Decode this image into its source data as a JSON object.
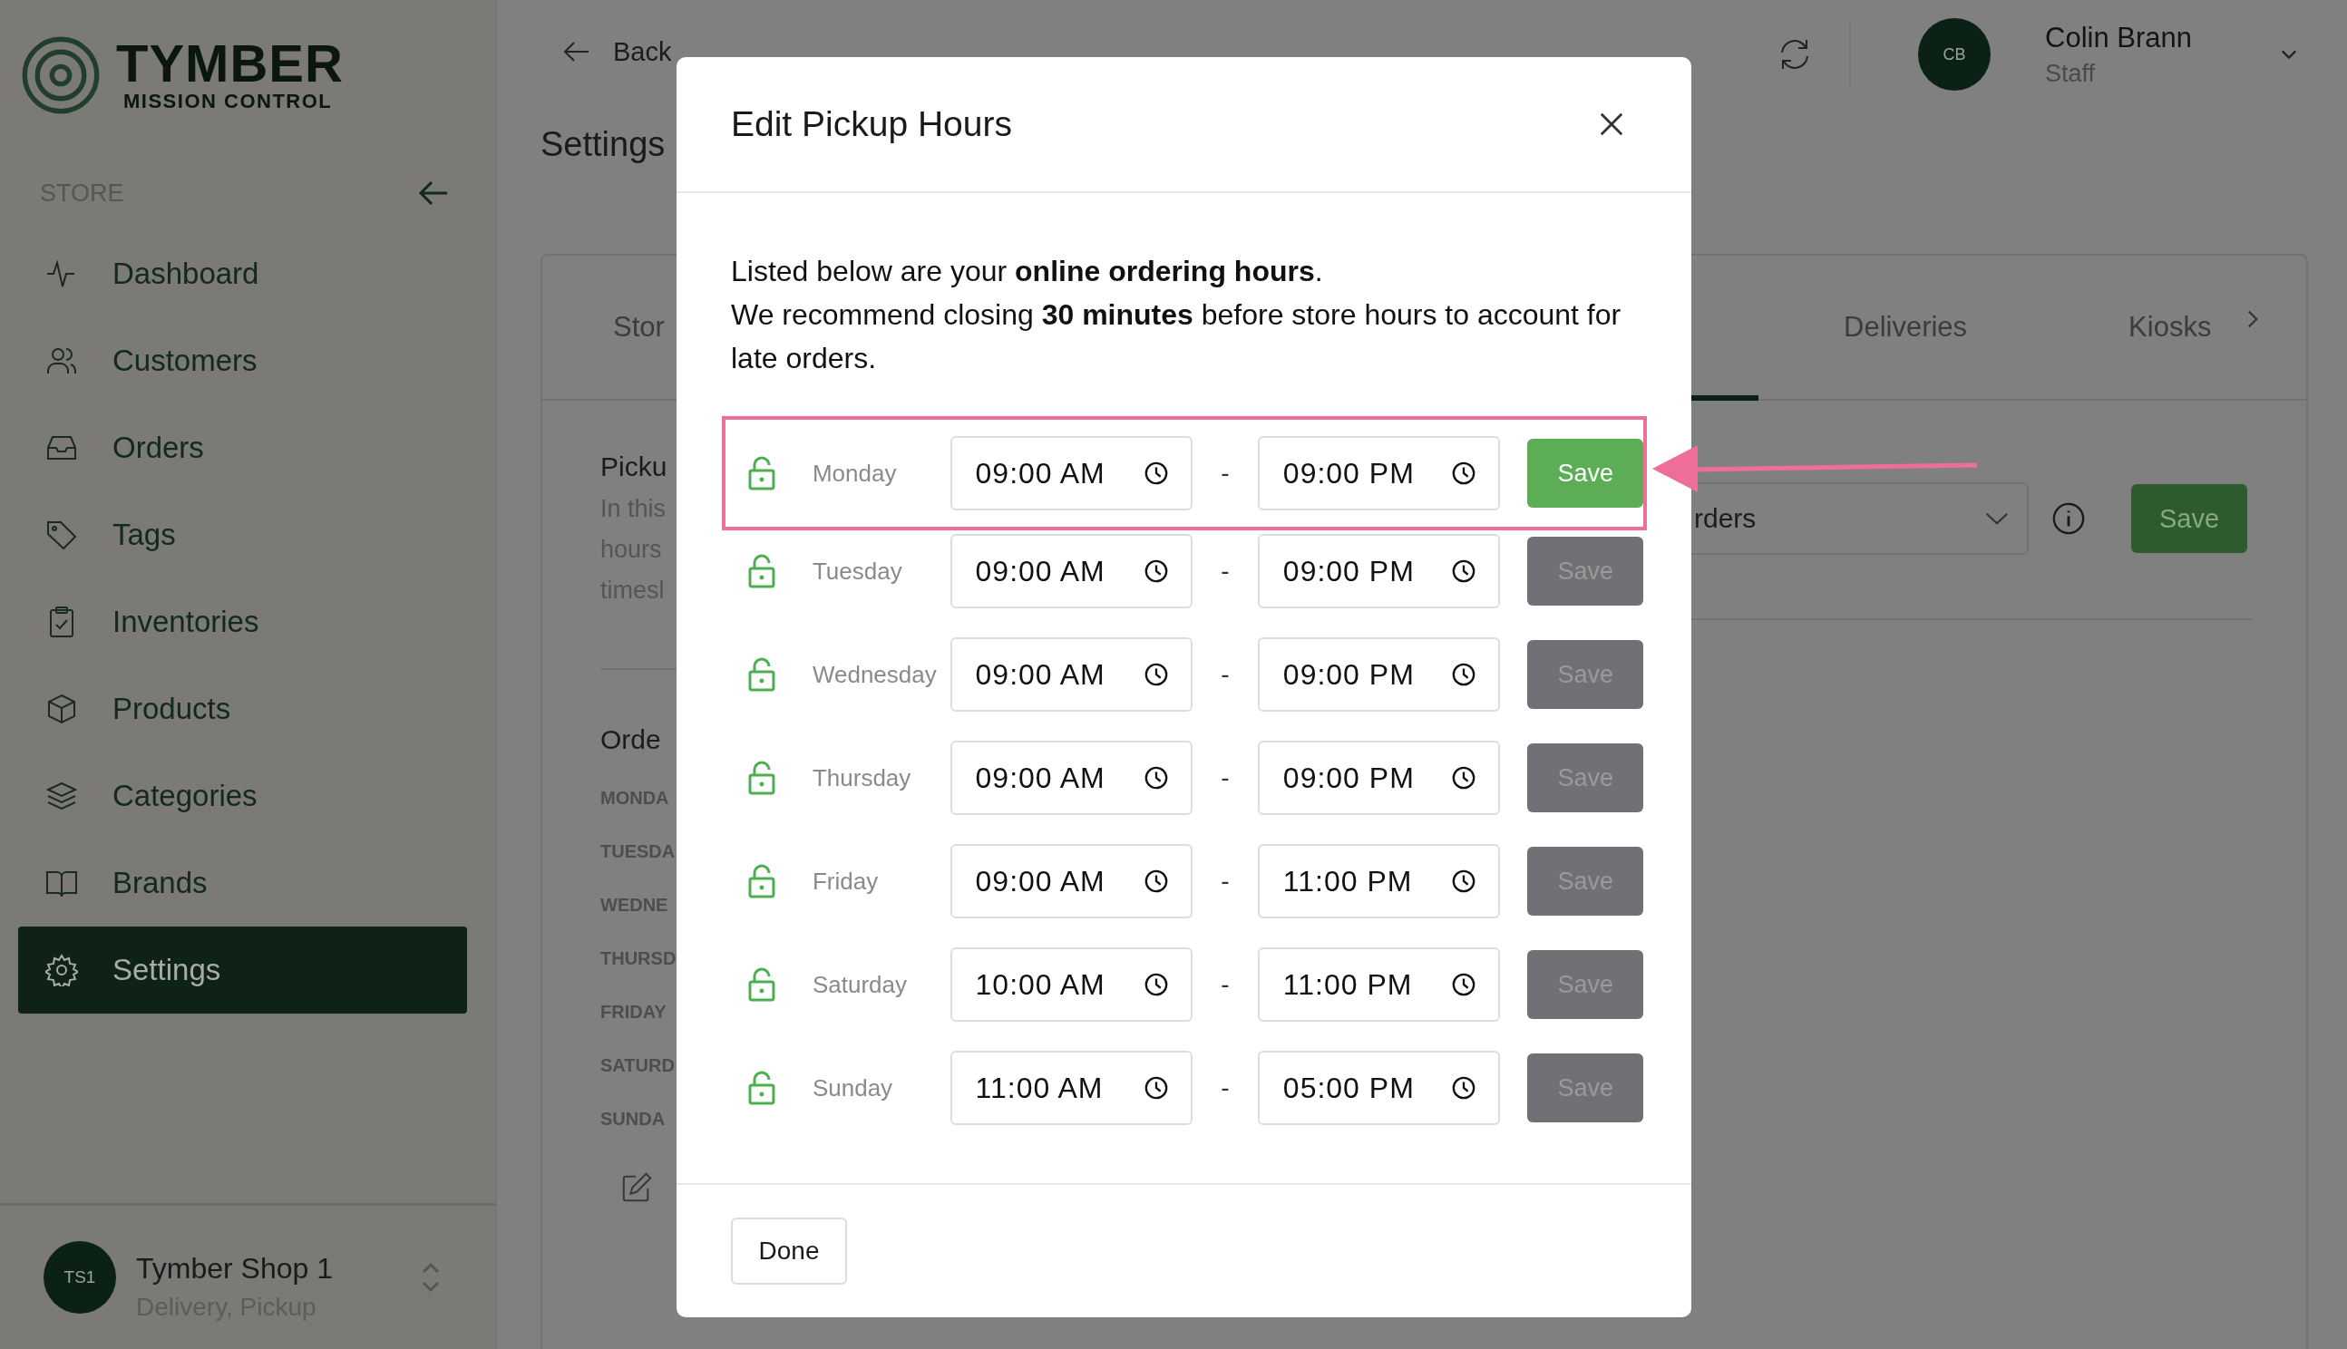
{
  "sidebar": {
    "logo": {
      "name": "TYMBER",
      "subtitle": "MISSION CONTROL"
    },
    "section": "STORE",
    "items": [
      {
        "label": "Dashboard",
        "selected": false
      },
      {
        "label": "Customers",
        "selected": false
      },
      {
        "label": "Orders",
        "selected": false
      },
      {
        "label": "Tags",
        "selected": false
      },
      {
        "label": "Inventories",
        "selected": false
      },
      {
        "label": "Products",
        "selected": false
      },
      {
        "label": "Categories",
        "selected": false
      },
      {
        "label": "Brands",
        "selected": false
      },
      {
        "label": "Settings",
        "selected": true
      }
    ],
    "store": {
      "initials": "TS1",
      "name": "Tymber Shop 1",
      "services": "Delivery, Pickup"
    }
  },
  "header": {
    "back": "Back",
    "user": {
      "initials": "CB",
      "name": "Colin Brann",
      "role": "Staff"
    }
  },
  "page": {
    "title": "Settings",
    "tabs": [
      {
        "label": "Stor",
        "selected": false
      },
      {
        "label": "Deliveries",
        "selected": false
      },
      {
        "label": "Kiosks",
        "selected": false
      }
    ],
    "pickup": {
      "heading": "Picku",
      "description": [
        "In this",
        "hours",
        "timesl"
      ],
      "select": {
        "value": "rders"
      },
      "save": "Save"
    },
    "orders": {
      "heading": "Orde",
      "days": [
        "MONDA",
        "TUESDA",
        "WEDNE",
        "THURSD",
        "FRIDAY",
        "SATURD",
        "SUNDA"
      ]
    }
  },
  "modal": {
    "title": "Edit Pickup Hours",
    "intro": [
      "Listed below are your **online ordering hours**.",
      "We recommend closing **30 minutes** before store hours to account for late orders."
    ],
    "hours": [
      {
        "day": "Monday",
        "locked": false,
        "start": "09:00 AM",
        "end": "09:00 PM",
        "save": "Save",
        "disabled": false,
        "highlighted": true
      },
      {
        "day": "Tuesday",
        "locked": false,
        "start": "09:00 AM",
        "end": "09:00 PM",
        "save": "Save",
        "disabled": true,
        "highlighted": false
      },
      {
        "day": "Wednesday",
        "locked": false,
        "start": "09:00 AM",
        "end": "09:00 PM",
        "save": "Save",
        "disabled": true,
        "highlighted": false
      },
      {
        "day": "Thursday",
        "locked": false,
        "start": "09:00 AM",
        "end": "09:00 PM",
        "save": "Save",
        "disabled": true,
        "highlighted": false
      },
      {
        "day": "Friday",
        "locked": false,
        "start": "09:00 AM",
        "end": "11:00 PM",
        "save": "Save",
        "disabled": true,
        "highlighted": false
      },
      {
        "day": "Saturday",
        "locked": false,
        "start": "10:00 AM",
        "end": "11:00 PM",
        "save": "Save",
        "disabled": true,
        "highlighted": false
      },
      {
        "day": "Sunday",
        "locked": false,
        "start": "11:00 AM",
        "end": "05:00 PM",
        "save": "Save",
        "disabled": true,
        "highlighted": false
      }
    ],
    "separator": "-",
    "done": "Done"
  }
}
